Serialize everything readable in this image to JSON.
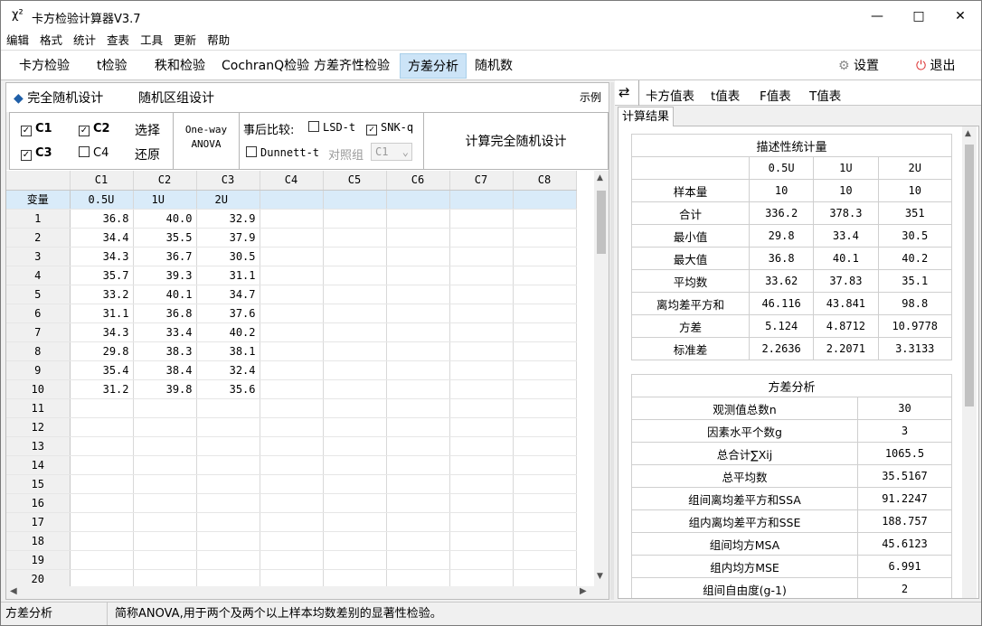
{
  "window": {
    "icon_text": "χ²",
    "title": "卡方检验计算器V3.7"
  },
  "menu": [
    "编辑",
    "格式",
    "统计",
    "查表",
    "工具",
    "更新",
    "帮助"
  ],
  "tabs": [
    "卡方检验",
    "t检验",
    "秩和检验",
    "CochranQ检验",
    "方差齐性检验",
    "方差分析",
    "随机数"
  ],
  "toolbar": {
    "settings": "设置",
    "exit": "退出"
  },
  "design": {
    "option1": "完全随机设计",
    "option2": "随机区组设计",
    "example": "示例"
  },
  "columns_select": {
    "c1": "C1",
    "c2": "C2",
    "c3": "C3",
    "c4": "C4",
    "c1_checked": true,
    "c2_checked": true,
    "c3_checked": true,
    "c4_checked": false,
    "select": "选择",
    "restore": "还原"
  },
  "anova_label": {
    "line1": "One-way",
    "line2": "ANOVA"
  },
  "posthoc": {
    "label": "事后比较:",
    "lsd": "LSD-t",
    "snk": "SNK-q",
    "dunnett": "Dunnett-t",
    "control_label": "对照组",
    "control_value": "C1",
    "lsd_checked": false,
    "snk_checked": true,
    "dunnett_checked": false
  },
  "compute_button": "计算完全随机设计",
  "grid": {
    "col_headers": [
      "C1",
      "C2",
      "C3",
      "C4",
      "C5",
      "C6",
      "C7",
      "C8"
    ],
    "var_label": "变量",
    "var_names": [
      "0.5U",
      "1U",
      "2U"
    ],
    "rows": [
      [
        "1",
        "36.8",
        "40.0",
        "32.9"
      ],
      [
        "2",
        "34.4",
        "35.5",
        "37.9"
      ],
      [
        "3",
        "34.3",
        "36.7",
        "30.5"
      ],
      [
        "4",
        "35.7",
        "39.3",
        "31.1"
      ],
      [
        "5",
        "33.2",
        "40.1",
        "34.7"
      ],
      [
        "6",
        "31.1",
        "36.8",
        "37.6"
      ],
      [
        "7",
        "34.3",
        "33.4",
        "40.2"
      ],
      [
        "8",
        "29.8",
        "38.3",
        "38.1"
      ],
      [
        "9",
        "35.4",
        "38.4",
        "32.4"
      ],
      [
        "10",
        "31.2",
        "39.8",
        "35.6"
      ],
      [
        "11"
      ],
      [
        "12"
      ],
      [
        "13"
      ],
      [
        "14"
      ],
      [
        "15"
      ],
      [
        "16"
      ],
      [
        "17"
      ],
      [
        "18"
      ],
      [
        "19"
      ],
      [
        "20"
      ]
    ]
  },
  "right_tabs": [
    "卡方值表",
    "t值表",
    "F值表",
    "T值表"
  ],
  "result_tab": "计算结果",
  "desc": {
    "title": "描述性统计量",
    "headers": [
      "0.5U",
      "1U",
      "2U"
    ],
    "rows": [
      {
        "label": "样本量",
        "v": [
          "10",
          "10",
          "10"
        ]
      },
      {
        "label": "合计",
        "v": [
          "336.2",
          "378.3",
          "351"
        ]
      },
      {
        "label": "最小值",
        "v": [
          "29.8",
          "33.4",
          "30.5"
        ]
      },
      {
        "label": "最大值",
        "v": [
          "36.8",
          "40.1",
          "40.2"
        ]
      },
      {
        "label": "平均数",
        "v": [
          "33.62",
          "37.83",
          "35.1"
        ]
      },
      {
        "label": "离均差平方和",
        "v": [
          "46.116",
          "43.841",
          "98.8"
        ]
      },
      {
        "label": "方差",
        "v": [
          "5.124",
          "4.8712",
          "10.9778"
        ]
      },
      {
        "label": "标准差",
        "v": [
          "2.2636",
          "2.2071",
          "3.3133"
        ]
      }
    ]
  },
  "anova": {
    "title": "方差分析",
    "rows": [
      {
        "label": "观测值总数n",
        "v": "30"
      },
      {
        "label": "因素水平个数g",
        "v": "3"
      },
      {
        "label": "总合计∑Xij",
        "v": "1065.5"
      },
      {
        "label": "总平均数",
        "v": "35.5167"
      },
      {
        "label": "组间离均差平方和SSA",
        "v": "91.2247"
      },
      {
        "label": "组内离均差平方和SSE",
        "v": "188.757"
      },
      {
        "label": "组间均方MSA",
        "v": "45.6123"
      },
      {
        "label": "组内均方MSE",
        "v": "6.991"
      },
      {
        "label": "组间自由度(g-1)",
        "v": "2"
      }
    ]
  },
  "status": {
    "left": "方差分析",
    "text": "简称ANOVA,用于两个及两个以上样本均数差别的显著性检验。"
  }
}
